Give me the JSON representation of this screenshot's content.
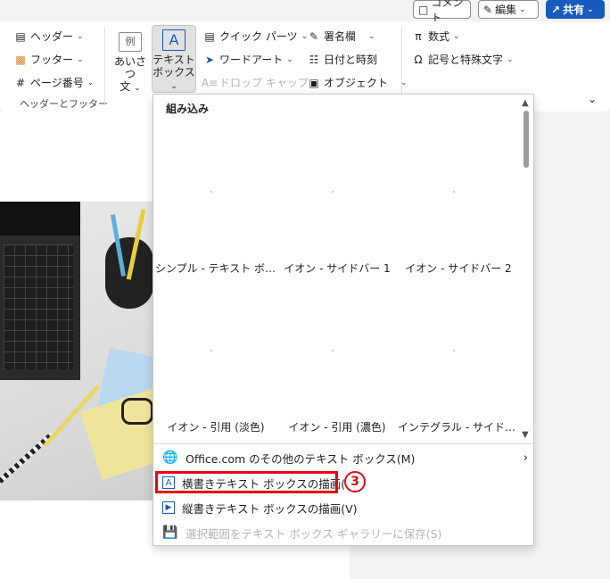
{
  "topbar": {
    "comment_label": "コメント",
    "edit_label": "編集",
    "share_label": "共有"
  },
  "ribbon": {
    "header_footer": {
      "header": "ヘッダー",
      "footer": "フッター",
      "page_number": "ページ番号",
      "group_label": "ヘッダーとフッター"
    },
    "greeting": {
      "icon_text": "例",
      "label_line1": "あいさつ",
      "label_line2": "文"
    },
    "textbox": {
      "icon_text": "A",
      "label_line1": "テキスト",
      "label_line2": "ボックス"
    },
    "quick_parts": "クイック パーツ",
    "wordart": "ワードアート",
    "drop_cap": "ドロップ キャップ",
    "signature_line": "署名欄",
    "date_time": "日付と時刻",
    "object": "オブジェクト",
    "equation": "数式",
    "symbols": "記号と特殊文字"
  },
  "panel": {
    "heading": "組み込み",
    "gallery": [
      {
        "caption": "シンプル - テキスト ボックス"
      },
      {
        "caption": "イオン - サイドバー 1"
      },
      {
        "caption": "イオン - サイドバー 2"
      },
      {
        "caption": "イオン - 引用 (淡色)"
      },
      {
        "caption": "イオン - 引用 (濃色)"
      },
      {
        "caption": "インテグラル - サイドバー"
      }
    ],
    "menu": {
      "more_office": "Office.com のその他のテキスト ボックス(M)",
      "draw_horizontal": "横書きテキスト ボックスの描画(H)",
      "draw_vertical": "縦書きテキスト ボックスの描画(V)",
      "save_selection": "選択範囲をテキスト ボックス ギャラリーに保存(S)"
    }
  },
  "annotation": {
    "step_badge": "3",
    "color": "#e10a14"
  },
  "colors": {
    "accent": "#185abd"
  }
}
